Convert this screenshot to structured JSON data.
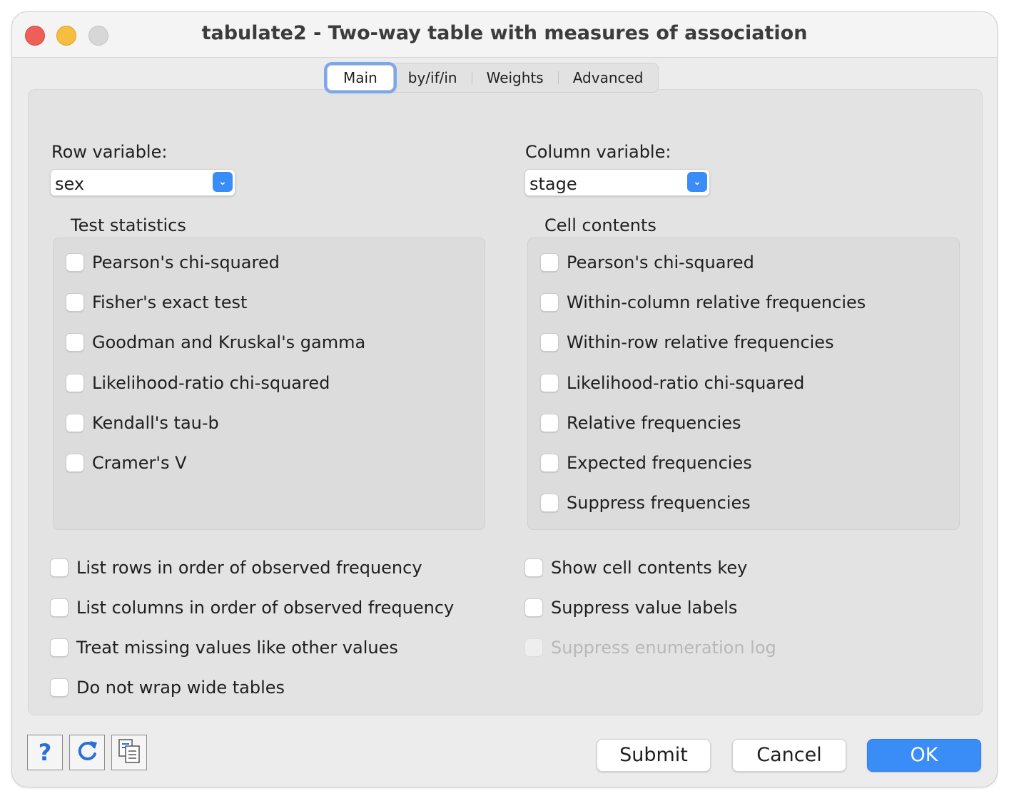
{
  "window": {
    "title": "tabulate2 - Two-way table with measures of association"
  },
  "tabs": [
    {
      "label": "Main",
      "active": true
    },
    {
      "label": "by/if/in",
      "active": false
    },
    {
      "label": "Weights",
      "active": false
    },
    {
      "label": "Advanced",
      "active": false
    }
  ],
  "row_variable": {
    "label": "Row variable:",
    "value": "sex"
  },
  "column_variable": {
    "label": "Column variable:",
    "value": "stage"
  },
  "test_statistics": {
    "title": "Test statistics",
    "items": [
      {
        "label": "Pearson's chi-squared",
        "checked": false
      },
      {
        "label": "Fisher's exact test",
        "checked": false
      },
      {
        "label": "Goodman and Kruskal's gamma",
        "checked": false
      },
      {
        "label": "Likelihood-ratio chi-squared",
        "checked": false
      },
      {
        "label": "Kendall's tau-b",
        "checked": false
      },
      {
        "label": "Cramer's V",
        "checked": false
      }
    ]
  },
  "cell_contents": {
    "title": "Cell contents",
    "items": [
      {
        "label": "Pearson's chi-squared",
        "checked": false
      },
      {
        "label": "Within-column relative frequencies",
        "checked": false
      },
      {
        "label": "Within-row relative frequencies",
        "checked": false
      },
      {
        "label": "Likelihood-ratio chi-squared",
        "checked": false
      },
      {
        "label": "Relative frequencies",
        "checked": false
      },
      {
        "label": "Expected frequencies",
        "checked": false
      },
      {
        "label": "Suppress frequencies",
        "checked": false
      }
    ]
  },
  "options_left": [
    {
      "label": "List rows in order of observed frequency",
      "checked": false
    },
    {
      "label": "List columns in order of observed frequency",
      "checked": false
    },
    {
      "label": "Treat missing values like other values",
      "checked": false
    },
    {
      "label": "Do not wrap wide tables",
      "checked": false
    }
  ],
  "options_right": [
    {
      "label": "Show cell contents key",
      "checked": false
    },
    {
      "label": "Suppress value labels",
      "checked": false
    },
    {
      "label": "Suppress enumeration log",
      "checked": false,
      "disabled": true
    }
  ],
  "footer": {
    "help_icon": "?",
    "reset_icon": "refresh-icon",
    "copy_icon": "copy-icon",
    "submit_label": "Submit",
    "cancel_label": "Cancel",
    "ok_label": "OK"
  },
  "colors": {
    "accent": "#3a8cf7",
    "close": "#ee5f57",
    "minimize": "#f5be3f"
  }
}
